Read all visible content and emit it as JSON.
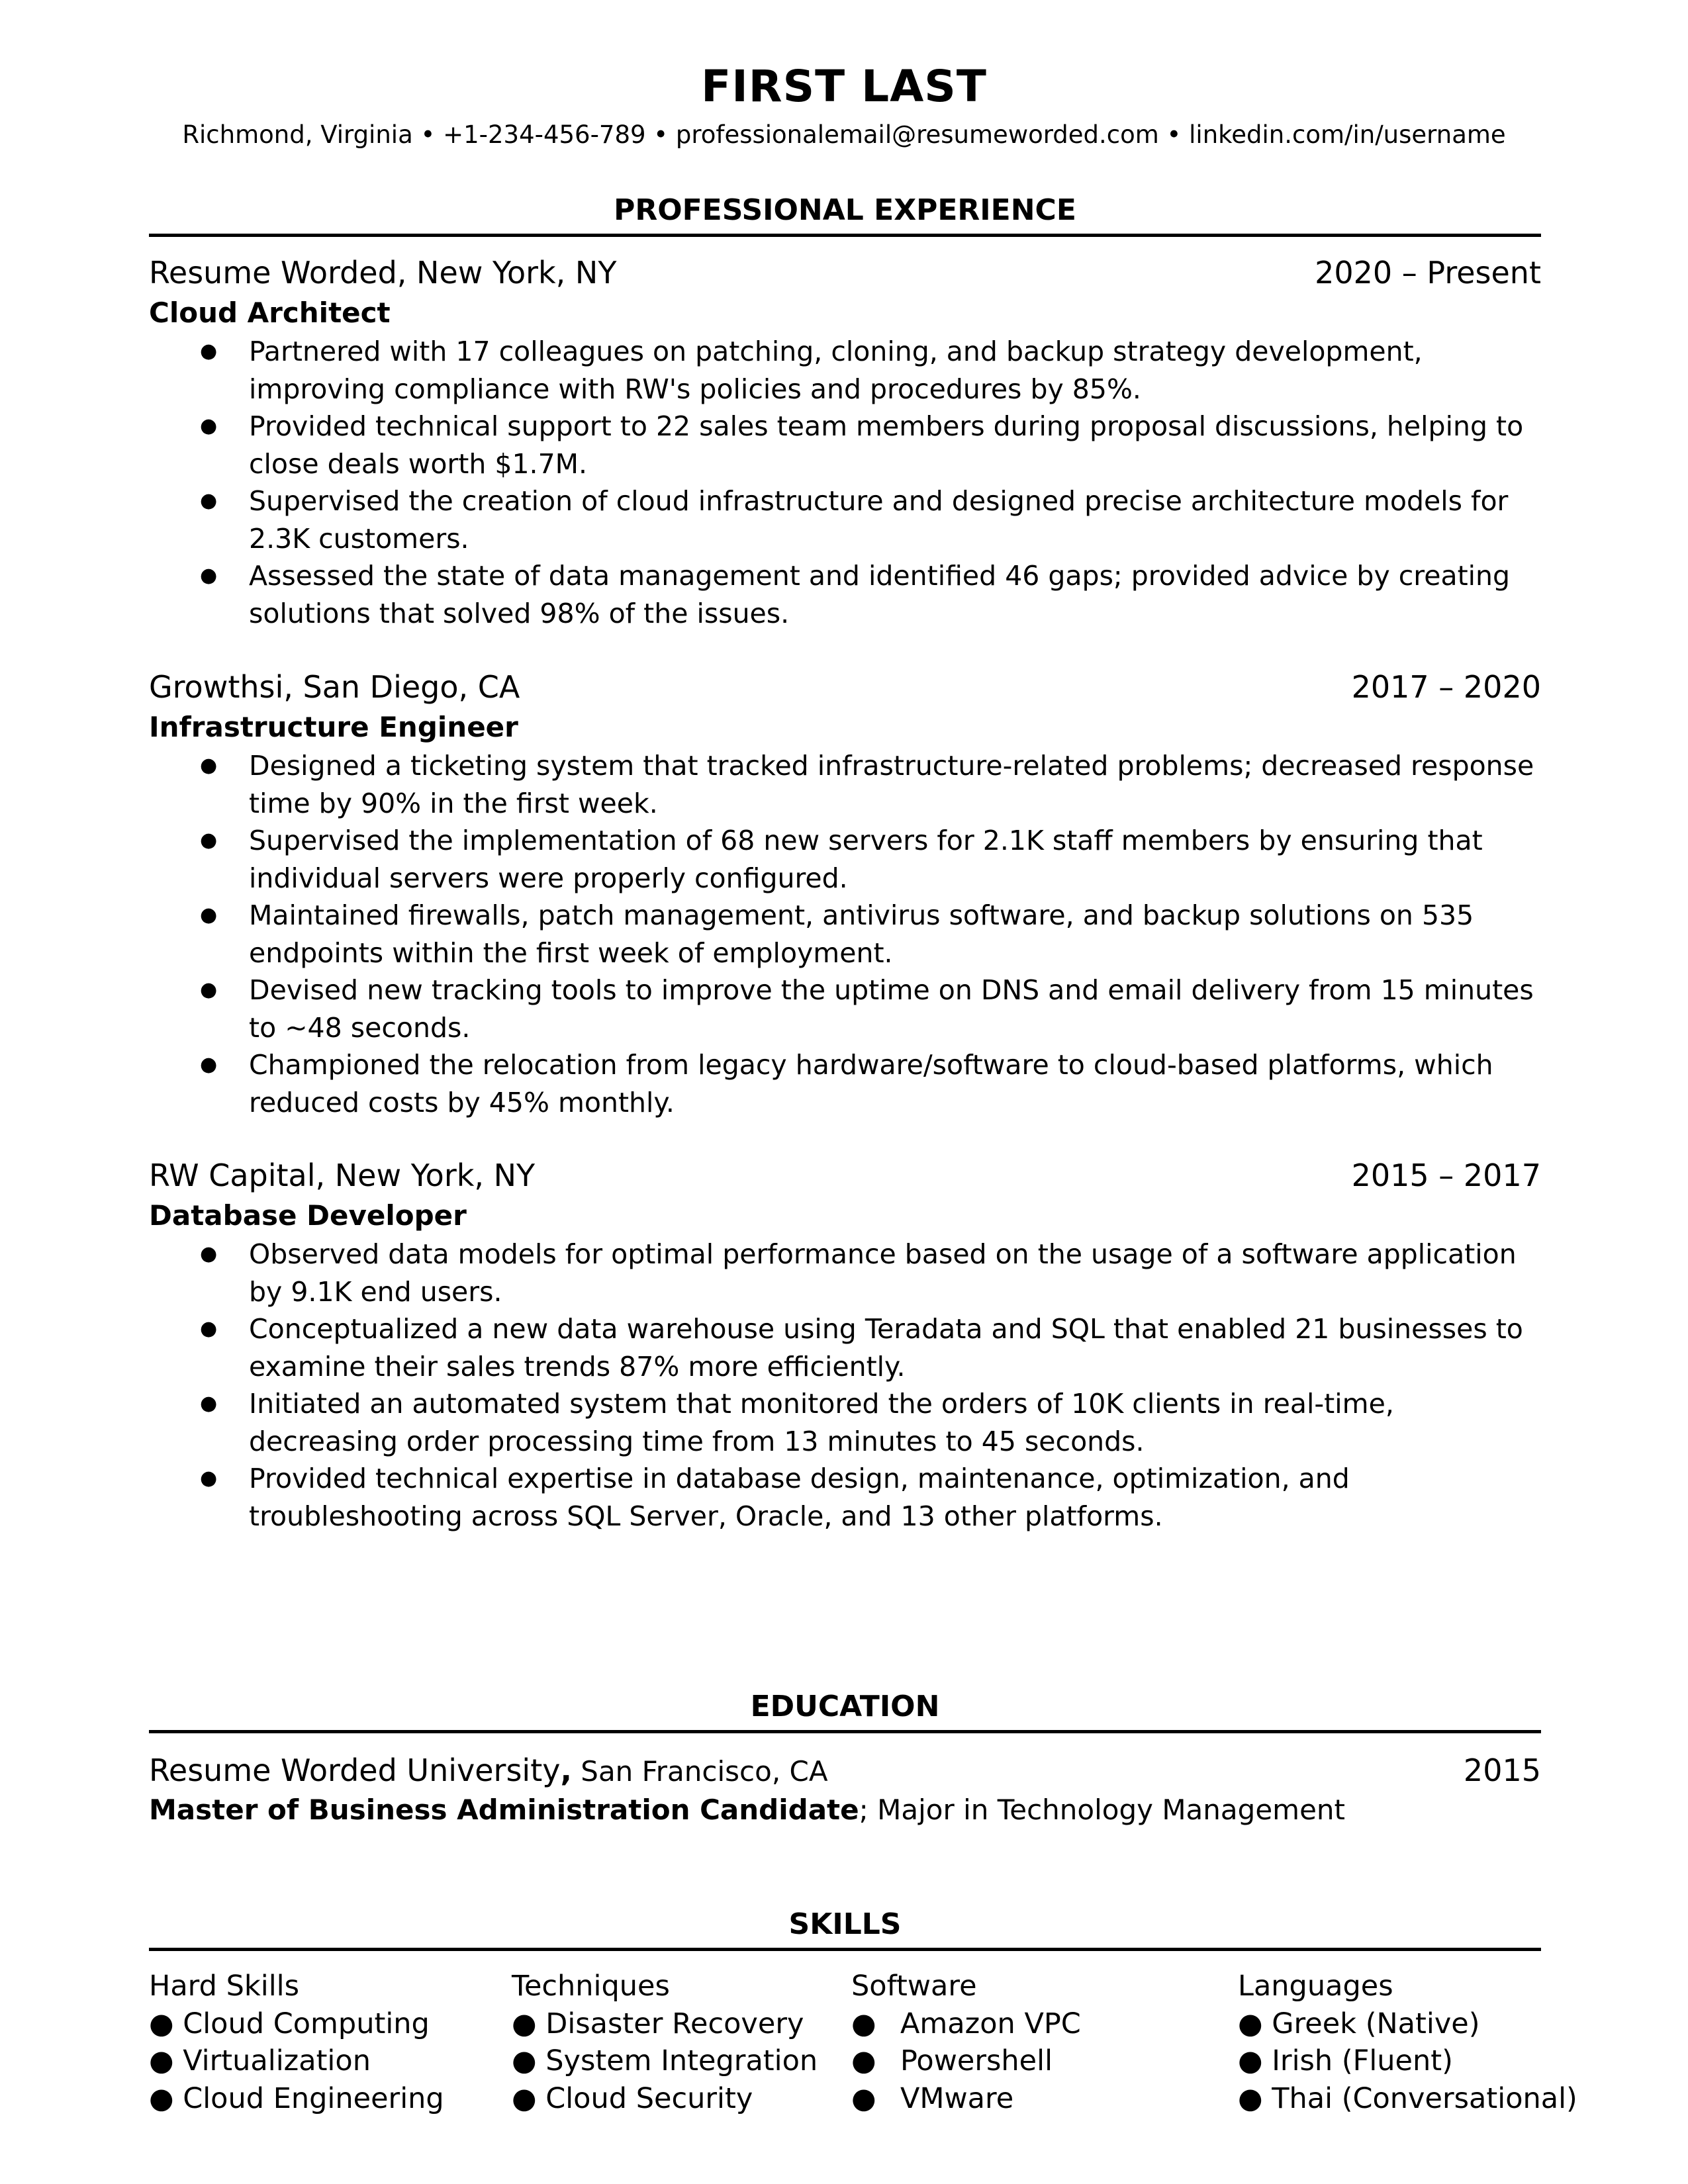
{
  "header": {
    "name": "FIRST LAST",
    "contact": "Richmond, Virginia  • +1-234-456-789 • professionalemail@resumeworded.com • linkedin.com/in/username"
  },
  "sections": {
    "experience_title": "PROFESSIONAL EXPERIENCE",
    "education_title": "EDUCATION",
    "skills_title": "SKILLS"
  },
  "bullet_glyph": "●",
  "experience": [
    {
      "company": "Resume Worded, New York, NY",
      "dates": "2020 – Present",
      "role": "Cloud Architect",
      "bullets": [
        "Partnered with 17 colleagues on patching, cloning, and backup strategy development, improving compliance with RW's policies and procedures by 85%.",
        "Provided technical support to 22 sales team members during proposal discussions, helping to close deals worth $1.7M.",
        "Supervised the creation of cloud infrastructure and designed precise architecture models for 2.3K customers.",
        "Assessed the state of data management and identified 46 gaps; provided advice by creating solutions that solved 98% of the issues."
      ]
    },
    {
      "company": "Growthsi, San Diego, CA",
      "dates": "2017 – 2020",
      "role": "Infrastructure Engineer",
      "bullets": [
        "Designed a ticketing system that tracked infrastructure-related problems; decreased response time by 90% in the first week.",
        "Supervised the implementation of 68 new servers for 2.1K staff members by ensuring that individual servers were properly configured.",
        "Maintained firewalls, patch management, antivirus software, and backup solutions on 535 endpoints within the first week of employment.",
        "Devised new tracking tools to improve the uptime on DNS and email delivery from 15 minutes to ~48 seconds.",
        "Championed the relocation from legacy hardware/software to cloud-based platforms, which reduced costs by 45% monthly."
      ]
    },
    {
      "company": "RW Capital, New York, NY",
      "dates": "2015 – 2017",
      "role": "Database Developer",
      "bullets": [
        "Observed data models for optimal performance based on the usage of a software application by 9.1K end users.",
        "Conceptualized a new data warehouse using Teradata and SQL that enabled 21 businesses to examine their sales trends 87% more efficiently.",
        "Initiated an automated system that monitored the orders of 10K clients in real-time, decreasing order processing time from 13 minutes to 45 seconds.",
        "Provided technical expertise in database design, maintenance, optimization, and troubleshooting across SQL Server, Oracle, and 13 other platforms."
      ]
    }
  ],
  "education": {
    "school": "Resume Worded University",
    "comma": ",",
    "location": " San Francisco, CA",
    "year": "2015",
    "degree": "Master of Business Administration Candidate",
    "major": "; Major in Technology Management"
  },
  "skills": {
    "hard_skills": {
      "header": "Hard Skills",
      "items": [
        "Cloud Computing",
        "Virtualization",
        "Cloud Engineering"
      ]
    },
    "techniques": {
      "header": "Techniques",
      "items": [
        "Disaster Recovery",
        "System Integration",
        "Cloud Security"
      ]
    },
    "software": {
      "header": "Software",
      "items": [
        "Amazon VPC",
        "Powershell",
        "VMware"
      ]
    },
    "languages": {
      "header": "Languages",
      "items": [
        "Greek (Native)",
        "Irish (Fluent)",
        "Thai (Conversational)"
      ]
    }
  }
}
